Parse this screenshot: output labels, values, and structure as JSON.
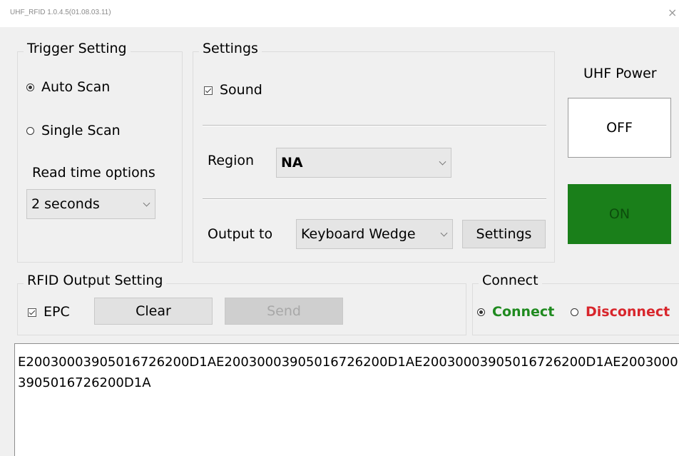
{
  "window": {
    "title": "UHF_RFID 1.0.4.5(01.08.03.11)",
    "close_glyph": "×"
  },
  "trigger": {
    "legend": "Trigger Setting",
    "auto_scan": {
      "label": "Auto Scan",
      "checked": true
    },
    "single_scan": {
      "label": "Single Scan",
      "checked": false
    },
    "read_time_label": "Read time options",
    "read_time_value": "2 seconds"
  },
  "settings": {
    "legend": "Settings",
    "sound": {
      "label": "Sound",
      "checked": true
    },
    "region_label": "Region",
    "region_value": "NA",
    "output_label": "Output to",
    "output_value": "Keyboard Wedge",
    "settings_button": "Settings"
  },
  "power": {
    "title": "UHF Power",
    "off_label": "OFF",
    "on_label": "ON",
    "on_color": "#1a7f1a",
    "on_text_color": "#0c4d0c"
  },
  "rfid_output": {
    "legend": "RFID Output Setting",
    "epc": {
      "label": "EPC",
      "checked": true
    },
    "clear_button": "Clear",
    "send_button": "Send"
  },
  "connect": {
    "legend": "Connect",
    "connect": {
      "label": "Connect",
      "checked": true,
      "color": "#1f8a1f"
    },
    "disconnect": {
      "label": "Disconnect",
      "checked": false,
      "color": "#d8262c"
    }
  },
  "output_text": "E2003000390501672620 0D1AE2003000390501672620 0D1AE200300039050167262 0 0D1AE2003000390501672620 0D1A"
}
